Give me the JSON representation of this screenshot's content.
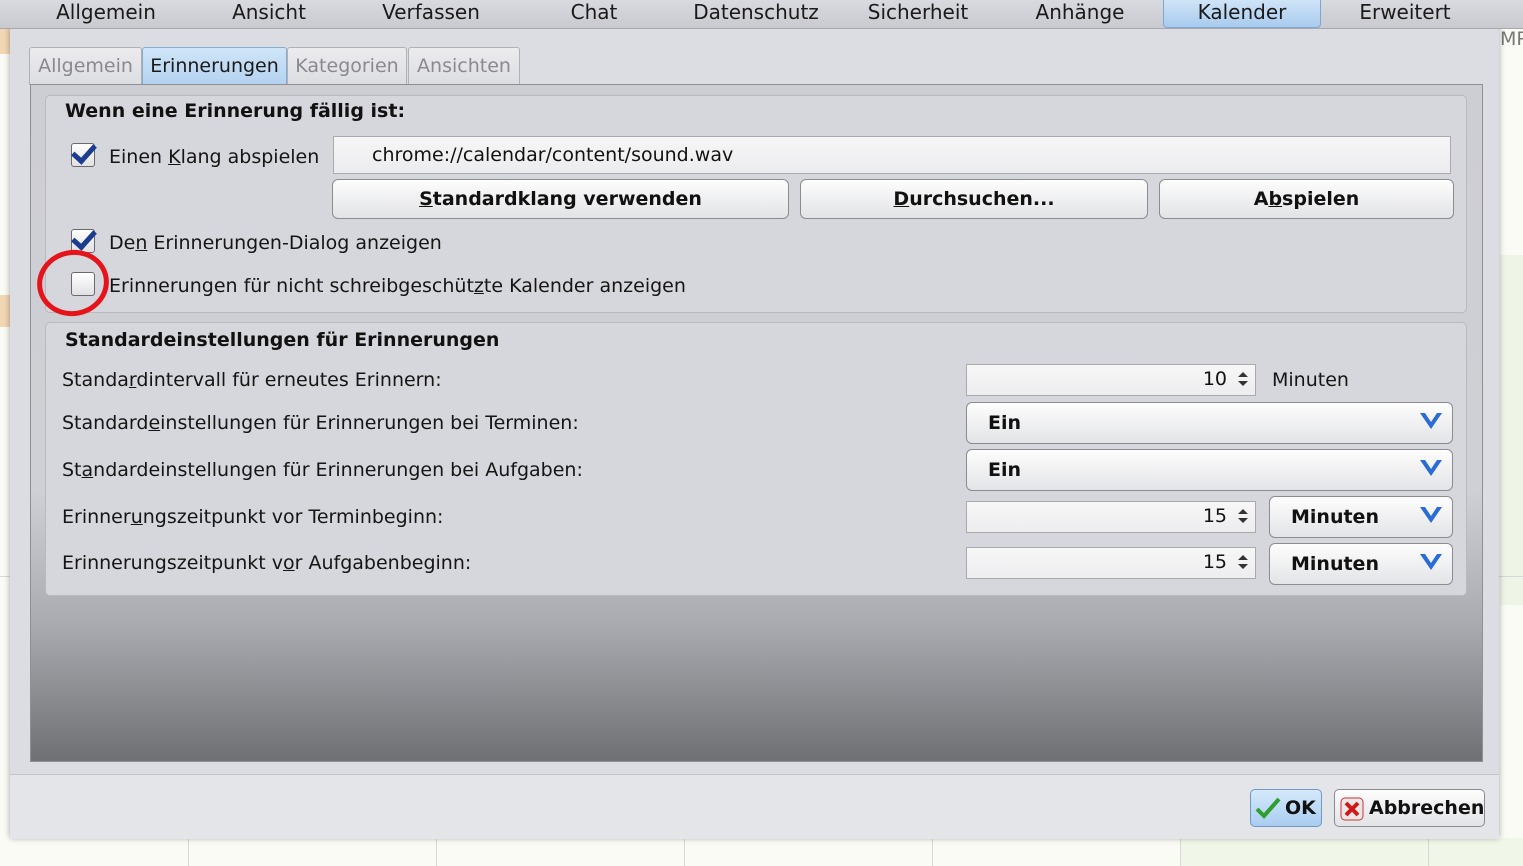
{
  "top_tabs": [
    {
      "label": "Allgemein"
    },
    {
      "label": "Ansicht"
    },
    {
      "label": "Verfassen"
    },
    {
      "label": "Chat"
    },
    {
      "label": "Datenschutz"
    },
    {
      "label": "Sicherheit"
    },
    {
      "label": "Anhänge"
    },
    {
      "label": "Kalender",
      "active": true
    },
    {
      "label": "Erweitert"
    }
  ],
  "sub_tabs": [
    {
      "label": "Allgemein"
    },
    {
      "label": "Erinnerungen",
      "active": true
    },
    {
      "label": "Kategorien"
    },
    {
      "label": "Ansichten"
    }
  ],
  "background": {
    "right_edge_text": "MP"
  },
  "reminder_due": {
    "title": "Wenn eine Erinnerung fällig ist:",
    "play_sound": {
      "label_pre": "Einen ",
      "label_key": "K",
      "label_post": "lang abspielen",
      "checked": true
    },
    "sound_path": "chrome://calendar/content/sound.wav",
    "default_sound_button": {
      "key": "S",
      "rest": "tandardklang verwenden"
    },
    "browse_button": {
      "key": "D",
      "rest": "urchsuchen..."
    },
    "play_button": {
      "pre": "A",
      "key": "b",
      "rest": "spielen"
    },
    "show_dialog": {
      "label_pre": "De",
      "label_key": "n",
      "label_post": " Erinnerungen-Dialog anzeigen",
      "checked": true
    },
    "show_writable_calendars": {
      "label_pre": "Erinnerungen für nicht schreibgeschüt",
      "label_key": "z",
      "label_post": "te Kalender anzeigen",
      "checked": false
    }
  },
  "defaults": {
    "title": "Standardeinstellungen für Erinnerungen",
    "snooze": {
      "label_pre": "Standa",
      "label_key": "r",
      "label_post": "dintervall für erneutes Erinnern:",
      "value": "10",
      "unit": "Minuten"
    },
    "events_default": {
      "label_pre": "Standard",
      "label_key": "e",
      "label_post": "instellungen für Erinnerungen bei Terminen:",
      "value": "Ein"
    },
    "tasks_default": {
      "label_pre": "St",
      "label_key": "a",
      "label_post": "ndardeinstellungen für Erinnerungen bei Aufgaben:",
      "value": "Ein"
    },
    "event_alarm": {
      "label_pre": "Erinner",
      "label_key": "u",
      "label_post": "ngszeitpunkt vor Terminbeginn:",
      "value": "15",
      "unit": "Minuten"
    },
    "task_alarm": {
      "label_pre": "Erinnerungszeitpunkt v",
      "label_key": "o",
      "label_post": "r Aufgabenbeginn:",
      "value": "15",
      "unit": "Minuten"
    }
  },
  "footer": {
    "ok_label": "OK",
    "cancel_label": "Abbrechen"
  },
  "colors": {
    "active_tab": "#a9cbee",
    "annotation_circle": "#e5141b",
    "checkbox_mark": "#1c3d8f"
  }
}
